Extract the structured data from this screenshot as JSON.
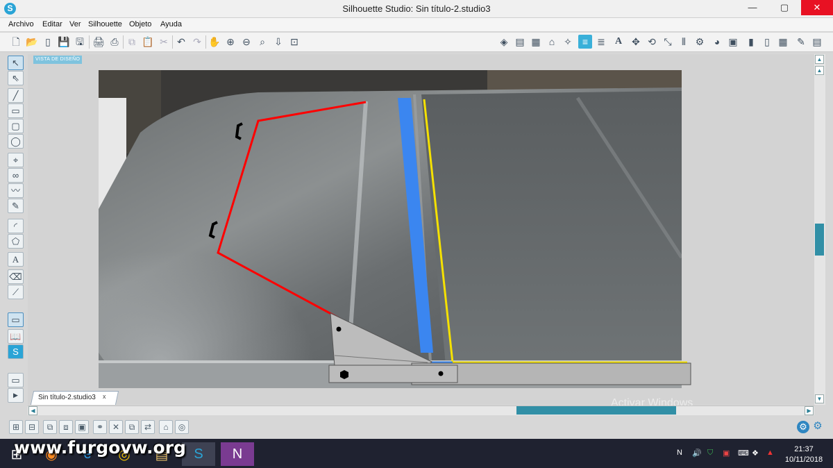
{
  "window": {
    "title": "Silhouette Studio: Sin título-2.studio3",
    "logo_letter": "S",
    "controls": {
      "minimize": "—",
      "maximize": "▢",
      "close": "✕"
    }
  },
  "menu": [
    "Archivo",
    "Editar",
    "Ver",
    "Silhouette",
    "Objeto",
    "Ayuda"
  ],
  "toolbar_left_icons": [
    "new-doc-icon",
    "open-folder-icon",
    "open-template-icon",
    "save-icon",
    "save-as-icon",
    "print-icon",
    "send-cut-icon",
    "copy-icon",
    "paste-icon",
    "cut-icon",
    "undo-icon",
    "redo-icon",
    "pan-hand-icon",
    "zoom-in-icon",
    "zoom-out-icon",
    "zoom-select-icon",
    "zoom-fit-icon",
    "zoom-page-icon"
  ],
  "toolbar_right_icons": [
    "fill-color-icon",
    "gradient-icon",
    "pattern-icon",
    "line-style-icon",
    "pixscan-icon",
    "line-color-icon",
    "line-thickness-icon",
    "text-icon",
    "transform-icon",
    "rotate-icon",
    "scale-icon",
    "align-icon",
    "replicate-icon",
    "modify-icon",
    "offset-icon",
    "trace-icon",
    "page-setup-icon",
    "cut-settings-icon",
    "grid-icon",
    "store-icon",
    "library-icon"
  ],
  "design_area": {
    "label": "VISTA DE DISEÑO",
    "photo_description_alt": "Foto del techo de una furgoneta con marcas de líneas"
  },
  "tab": {
    "label": "Sin título-2.studio3",
    "close": "x"
  },
  "overlay": {
    "activate_windows": "Activar Windows"
  },
  "watermark": "www.furgovw.org",
  "clock": {
    "time": "21:37",
    "date": "10/11/2018"
  },
  "colors": {
    "accent": "#3ab0d9",
    "scroll": "#318fa6",
    "red_line": "#ff0000",
    "blue_strip": "#3b86f0",
    "yellow_line": "#f5e100",
    "bracket": "#bcbcbc"
  }
}
